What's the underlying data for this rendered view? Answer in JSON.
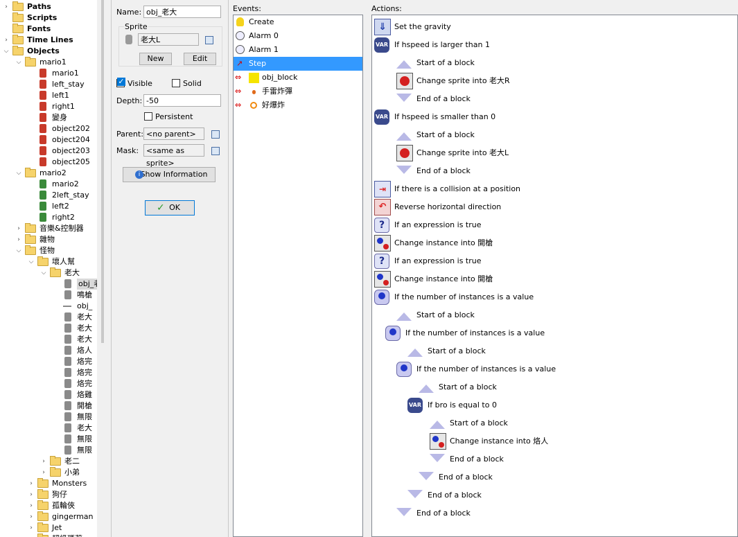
{
  "tree": {
    "items": [
      {
        "label": "Paths",
        "depth": 0,
        "bold": true,
        "toggle": "›",
        "icon": "folder"
      },
      {
        "label": "Scripts",
        "depth": 0,
        "bold": true,
        "toggle": "",
        "icon": "folder"
      },
      {
        "label": "Fonts",
        "depth": 0,
        "bold": true,
        "toggle": "",
        "icon": "folder"
      },
      {
        "label": "Time Lines",
        "depth": 0,
        "bold": true,
        "toggle": "›",
        "icon": "folder"
      },
      {
        "label": "Objects",
        "depth": 0,
        "bold": true,
        "toggle": "⌄",
        "icon": "folder"
      },
      {
        "label": "mario1",
        "depth": 1,
        "bold": false,
        "toggle": "⌄",
        "icon": "folder"
      },
      {
        "label": "mario1",
        "depth": 2,
        "bold": false,
        "toggle": "",
        "icon": "sprite-red"
      },
      {
        "label": "left_stay",
        "depth": 2,
        "bold": false,
        "toggle": "",
        "icon": "sprite-red"
      },
      {
        "label": "left1",
        "depth": 2,
        "bold": false,
        "toggle": "",
        "icon": "sprite-red"
      },
      {
        "label": "right1",
        "depth": 2,
        "bold": false,
        "toggle": "",
        "icon": "sprite-red"
      },
      {
        "label": "變身",
        "depth": 2,
        "bold": false,
        "toggle": "",
        "icon": "sprite-red"
      },
      {
        "label": "object202",
        "depth": 2,
        "bold": false,
        "toggle": "",
        "icon": "sprite-red"
      },
      {
        "label": "object204",
        "depth": 2,
        "bold": false,
        "toggle": "",
        "icon": "sprite-red"
      },
      {
        "label": "object203",
        "depth": 2,
        "bold": false,
        "toggle": "",
        "icon": "sprite-red"
      },
      {
        "label": "object205",
        "depth": 2,
        "bold": false,
        "toggle": "",
        "icon": "sprite-red"
      },
      {
        "label": "mario2",
        "depth": 1,
        "bold": false,
        "toggle": "⌄",
        "icon": "folder"
      },
      {
        "label": "mario2",
        "depth": 2,
        "bold": false,
        "toggle": "",
        "icon": "sprite-green"
      },
      {
        "label": "2left_stay",
        "depth": 2,
        "bold": false,
        "toggle": "",
        "icon": "sprite-green"
      },
      {
        "label": "left2",
        "depth": 2,
        "bold": false,
        "toggle": "",
        "icon": "sprite-green"
      },
      {
        "label": "right2",
        "depth": 2,
        "bold": false,
        "toggle": "",
        "icon": "sprite-green"
      },
      {
        "label": "音樂&控制器",
        "depth": 1,
        "bold": false,
        "toggle": "›",
        "icon": "folder"
      },
      {
        "label": "雜物",
        "depth": 1,
        "bold": false,
        "toggle": "›",
        "icon": "folder"
      },
      {
        "label": "怪物",
        "depth": 1,
        "bold": false,
        "toggle": "⌄",
        "icon": "folder"
      },
      {
        "label": "壞人幫",
        "depth": 2,
        "bold": false,
        "toggle": "⌄",
        "icon": "folder"
      },
      {
        "label": "老大",
        "depth": 3,
        "bold": false,
        "toggle": "⌄",
        "icon": "folder"
      },
      {
        "label": "obj_老大",
        "depth": 4,
        "bold": false,
        "toggle": "",
        "icon": "sprite-gray",
        "selected": true
      },
      {
        "label": "鳴槍",
        "depth": 4,
        "bold": false,
        "toggle": "",
        "icon": "sprite-gray"
      },
      {
        "label": "obj_",
        "depth": 4,
        "bold": false,
        "toggle": "",
        "icon": "line"
      },
      {
        "label": "老大",
        "depth": 4,
        "bold": false,
        "toggle": "",
        "icon": "sprite-gray"
      },
      {
        "label": "老大",
        "depth": 4,
        "bold": false,
        "toggle": "",
        "icon": "sprite-gray"
      },
      {
        "label": "老大",
        "depth": 4,
        "bold": false,
        "toggle": "",
        "icon": "sprite-gray"
      },
      {
        "label": "烙人",
        "depth": 4,
        "bold": false,
        "toggle": "",
        "icon": "sprite-gray"
      },
      {
        "label": "烙完",
        "depth": 4,
        "bold": false,
        "toggle": "",
        "icon": "sprite-gray"
      },
      {
        "label": "烙完",
        "depth": 4,
        "bold": false,
        "toggle": "",
        "icon": "sprite-gray"
      },
      {
        "label": "烙完",
        "depth": 4,
        "bold": false,
        "toggle": "",
        "icon": "sprite-gray"
      },
      {
        "label": "烙雞",
        "depth": 4,
        "bold": false,
        "toggle": "",
        "icon": "sprite-gray"
      },
      {
        "label": "開槍",
        "depth": 4,
        "bold": false,
        "toggle": "",
        "icon": "sprite-gray"
      },
      {
        "label": "無限",
        "depth": 4,
        "bold": false,
        "toggle": "",
        "icon": "sprite-gray"
      },
      {
        "label": "老大",
        "depth": 4,
        "bold": false,
        "toggle": "",
        "icon": "sprite-gray"
      },
      {
        "label": "無限",
        "depth": 4,
        "bold": false,
        "toggle": "",
        "icon": "sprite-gray"
      },
      {
        "label": "無限",
        "depth": 4,
        "bold": false,
        "toggle": "",
        "icon": "sprite-gray"
      },
      {
        "label": "老二",
        "depth": 3,
        "bold": false,
        "toggle": "›",
        "icon": "folder"
      },
      {
        "label": "小弟",
        "depth": 3,
        "bold": false,
        "toggle": "›",
        "icon": "folder"
      },
      {
        "label": "Monsters",
        "depth": 2,
        "bold": false,
        "toggle": "›",
        "icon": "folder"
      },
      {
        "label": "狗仔",
        "depth": 2,
        "bold": false,
        "toggle": "›",
        "icon": "folder"
      },
      {
        "label": "孤輪俠",
        "depth": 2,
        "bold": false,
        "toggle": "›",
        "icon": "folder"
      },
      {
        "label": "gingerman",
        "depth": 2,
        "bold": false,
        "toggle": "›",
        "icon": "folder"
      },
      {
        "label": "Jet",
        "depth": 2,
        "bold": false,
        "toggle": "›",
        "icon": "folder"
      },
      {
        "label": "超級瑪莉",
        "depth": 2,
        "bold": false,
        "toggle": "›",
        "icon": "folder"
      }
    ]
  },
  "props": {
    "name_label": "Name:",
    "name_value": "obj_老大",
    "sprite_group": "Sprite",
    "sprite_value": "老大L",
    "new_btn": "New",
    "edit_btn": "Edit",
    "visible_label": "Visible",
    "visible_checked": true,
    "solid_label": "Solid",
    "solid_checked": false,
    "depth_label": "Depth:",
    "depth_value": "-50",
    "persistent_label": "Persistent",
    "persistent_checked": false,
    "parent_label": "Parent:",
    "parent_value": "<no parent>",
    "mask_label": "Mask:",
    "mask_value": "<same as sprite>",
    "show_info_btn": "Show Information",
    "ok_btn": "OK"
  },
  "events": {
    "header": "Events:",
    "items": [
      {
        "label": "Create",
        "icon": "bulb-icon",
        "selected": false
      },
      {
        "label": "Alarm 0",
        "icon": "clock-icon",
        "selected": false
      },
      {
        "label": "Alarm 1",
        "icon": "clock-icon",
        "selected": false
      },
      {
        "label": "Step",
        "icon": "step-icon",
        "selected": true
      },
      {
        "label": "obj_block",
        "icon": "collision-icon",
        "selected": false
      },
      {
        "label": "手雷炸彈",
        "icon": "collision-icon",
        "selected": false
      },
      {
        "label": "好爆炸",
        "icon": "collision-icon",
        "selected": false
      }
    ]
  },
  "actions": {
    "header": "Actions:",
    "items": [
      {
        "label": "Set the gravity",
        "icon": "gravity",
        "indent": 0
      },
      {
        "label": "If hspeed is larger than 1",
        "icon": "var",
        "indent": 0
      },
      {
        "label": "Start of a block",
        "icon": "block-start",
        "indent": 1
      },
      {
        "label": "Change sprite into 老大R",
        "icon": "sprite-change",
        "indent": 1
      },
      {
        "label": "End of a block",
        "icon": "block-end",
        "indent": 1
      },
      {
        "label": "If hspeed is smaller than 0",
        "icon": "var",
        "indent": 0
      },
      {
        "label": "Start of a block",
        "icon": "block-start",
        "indent": 1
      },
      {
        "label": "Change sprite into 老大L",
        "icon": "sprite-change",
        "indent": 1
      },
      {
        "label": "End of a block",
        "icon": "block-end",
        "indent": 1
      },
      {
        "label": "If there is a collision at a position",
        "icon": "collision-check",
        "indent": 0
      },
      {
        "label": "Reverse horizontal direction",
        "icon": "reverse",
        "indent": 0
      },
      {
        "label": "If an expression is true",
        "icon": "question",
        "indent": 0
      },
      {
        "label": "Change instance into 開槍",
        "icon": "instance-change",
        "indent": 0
      },
      {
        "label": "If an expression is true",
        "icon": "question",
        "indent": 0
      },
      {
        "label": "Change instance into 開槍",
        "icon": "instance-change",
        "indent": 0
      },
      {
        "label": "If the number of instances is a value",
        "icon": "count",
        "indent": 0
      },
      {
        "label": "Start of a block",
        "icon": "block-start",
        "indent": 1
      },
      {
        "label": "If the number of instances is a value",
        "icon": "count",
        "indent": 1
      },
      {
        "label": "Start of a block",
        "icon": "block-start",
        "indent": 2
      },
      {
        "label": "If the number of instances is a value",
        "icon": "count",
        "indent": 2
      },
      {
        "label": "Start of a block",
        "icon": "block-start",
        "indent": 3
      },
      {
        "label": "If bro is equal to 0",
        "icon": "var",
        "indent": 3
      },
      {
        "label": "Start of a block",
        "icon": "block-start",
        "indent": 4
      },
      {
        "label": "Change instance into 烙人",
        "icon": "instance-change",
        "indent": 4
      },
      {
        "label": "End of a block",
        "icon": "block-end",
        "indent": 4
      },
      {
        "label": "End of a block",
        "icon": "block-end",
        "indent": 3
      },
      {
        "label": "End of a block",
        "icon": "block-end",
        "indent": 2
      },
      {
        "label": "End of a block",
        "icon": "block-end",
        "indent": 1
      }
    ]
  },
  "colors": {
    "selection": "#3399ff",
    "tree_selection": "#d9d9d9",
    "block_arrow": "#b9b9e6",
    "var_icon": "#3a4a8c"
  }
}
